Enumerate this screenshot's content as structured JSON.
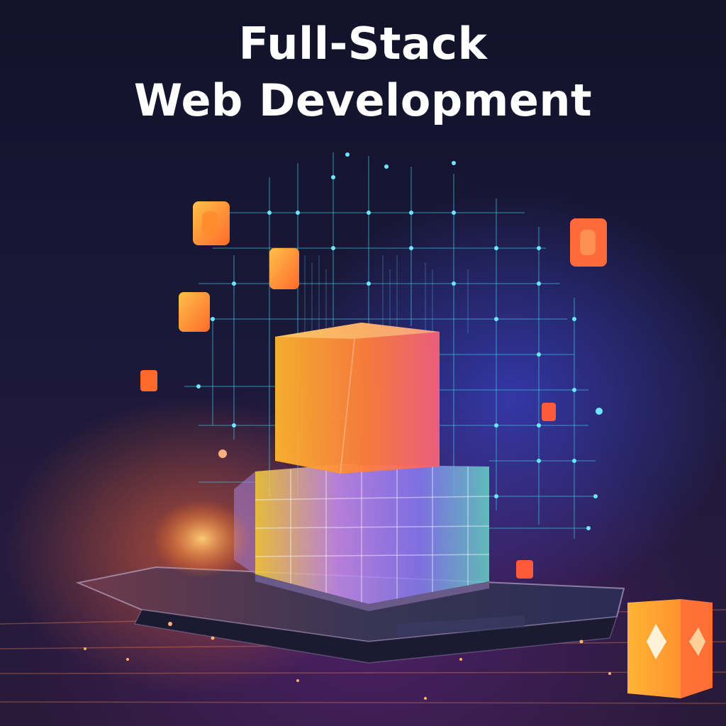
{
  "poster": {
    "title_line_1": "Full-Stack",
    "title_line_2": "Web Development"
  },
  "colors": {
    "background": "#171633",
    "cube_orange": "#ff9a2e",
    "cube_pink": "#f0567a",
    "grid_cyan": "#3ec7e0",
    "glow_blue": "#4a5cff"
  },
  "icons": [
    "orange-tile-icon",
    "laptop-icon",
    "server-stack-icon",
    "network-grid-icon"
  ]
}
